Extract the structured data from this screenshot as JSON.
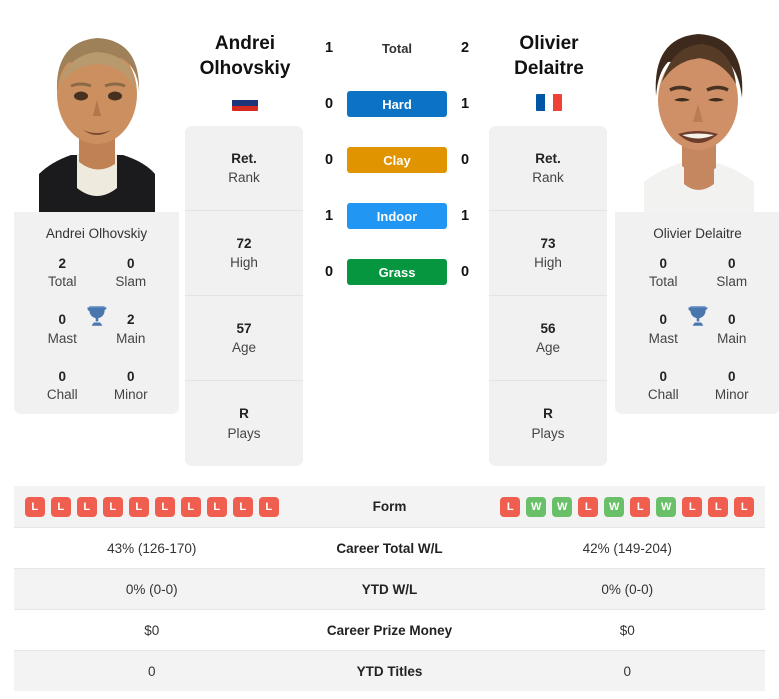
{
  "left_player": {
    "first_name": "Andrei",
    "last_name": "Olhovskiy",
    "full_name": "Andrei Olhovskiy",
    "flag": "russia-flag",
    "rank_value": "Ret.",
    "rank_label": "Rank",
    "high_value": "72",
    "high_label": "High",
    "age_value": "57",
    "age_label": "Age",
    "plays_value": "R",
    "plays_label": "Plays",
    "titles": {
      "total_value": "2",
      "total_label": "Total",
      "slam_value": "0",
      "slam_label": "Slam",
      "mast_value": "0",
      "mast_label": "Mast",
      "main_value": "2",
      "main_label": "Main",
      "chall_value": "0",
      "chall_label": "Chall",
      "minor_value": "0",
      "minor_label": "Minor"
    }
  },
  "right_player": {
    "first_name": "Olivier",
    "last_name": "Delaitre",
    "full_name": "Olivier Delaitre",
    "flag": "france-flag",
    "rank_value": "Ret.",
    "rank_label": "Rank",
    "high_value": "73",
    "high_label": "High",
    "age_value": "56",
    "age_label": "Age",
    "plays_value": "R",
    "plays_label": "Plays",
    "titles": {
      "total_value": "0",
      "total_label": "Total",
      "slam_value": "0",
      "slam_label": "Slam",
      "mast_value": "0",
      "mast_label": "Mast",
      "main_value": "0",
      "main_label": "Main",
      "chall_value": "0",
      "chall_label": "Chall",
      "minor_value": "0",
      "minor_label": "Minor"
    }
  },
  "h2h": [
    {
      "label": "Total",
      "left": "1",
      "right": "2",
      "color": "none",
      "is_total": true
    },
    {
      "label": "Hard",
      "left": "0",
      "right": "1",
      "color": "#0b72c4",
      "is_total": false
    },
    {
      "label": "Clay",
      "left": "0",
      "right": "0",
      "color": "#e09400",
      "is_total": false
    },
    {
      "label": "Indoor",
      "left": "1",
      "right": "1",
      "color": "#2196f3",
      "is_total": false
    },
    {
      "label": "Grass",
      "left": "0",
      "right": "0",
      "color": "#069640",
      "is_total": false
    }
  ],
  "colors": {
    "win": "#6abf69",
    "loss": "#ef5e4e",
    "panel": "#f1f1f1",
    "row_alt": "#f3f3f3"
  },
  "table": {
    "rows": [
      {
        "label": "Form",
        "type": "form",
        "left_form": [
          "L",
          "L",
          "L",
          "L",
          "L",
          "L",
          "L",
          "L",
          "L",
          "L"
        ],
        "right_form": [
          "L",
          "W",
          "W",
          "L",
          "W",
          "L",
          "W",
          "L",
          "L",
          "L"
        ]
      },
      {
        "label": "Career Total W/L",
        "type": "text",
        "left": "43% (126-170)",
        "right": "42% (149-204)"
      },
      {
        "label": "YTD W/L",
        "type": "text",
        "left": "0% (0-0)",
        "right": "0% (0-0)"
      },
      {
        "label": "Career Prize Money",
        "type": "text",
        "left": "$0",
        "right": "$0"
      },
      {
        "label": "YTD Titles",
        "type": "text",
        "left": "0",
        "right": "0"
      }
    ]
  }
}
